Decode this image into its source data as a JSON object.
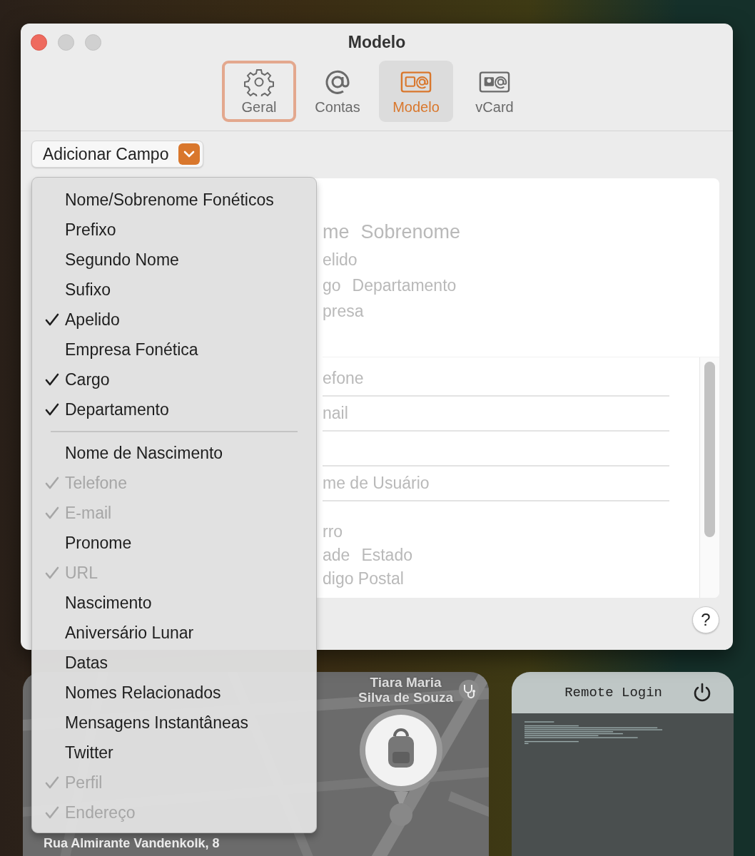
{
  "window": {
    "title": "Modelo"
  },
  "toolbar": [
    {
      "label": "Geral",
      "kind": "gear",
      "selected": false,
      "focused": true
    },
    {
      "label": "Contas",
      "kind": "at",
      "selected": false,
      "focused": false
    },
    {
      "label": "Modelo",
      "kind": "template",
      "selected": true,
      "focused": false
    },
    {
      "label": "vCard",
      "kind": "vcard",
      "selected": false,
      "focused": false
    }
  ],
  "add_field_button": {
    "label": "Adicionar Campo"
  },
  "template_preview": [
    {
      "kind": "name",
      "texts": [
        "me",
        "Sobrenome"
      ]
    },
    {
      "kind": "line",
      "texts": [
        "elido"
      ]
    },
    {
      "kind": "line",
      "texts": [
        "go",
        "Departamento"
      ]
    },
    {
      "kind": "line",
      "texts": [
        "presa"
      ]
    },
    {
      "kind": "field",
      "texts": [
        "efone"
      ]
    },
    {
      "kind": "field",
      "texts": [
        "nail"
      ]
    },
    {
      "kind": "field"
    },
    {
      "kind": "field",
      "texts": [
        "me de Usuário"
      ]
    },
    {
      "kind": "address",
      "texts": [
        "rro"
      ]
    },
    {
      "kind": "address",
      "texts": [
        "ade",
        "Estado"
      ]
    },
    {
      "kind": "address",
      "texts": [
        "digo Postal"
      ]
    }
  ],
  "help_button": {
    "label": "?"
  },
  "menu": {
    "groups": [
      [
        {
          "label": "Nome/Sobrenome Fonéticos",
          "checked": false,
          "disabled": false
        },
        {
          "label": "Prefixo",
          "checked": false,
          "disabled": false
        },
        {
          "label": "Segundo Nome",
          "checked": false,
          "disabled": false
        },
        {
          "label": "Sufixo",
          "checked": false,
          "disabled": false
        },
        {
          "label": "Apelido",
          "checked": true,
          "disabled": false
        },
        {
          "label": "Empresa Fonética",
          "checked": false,
          "disabled": false
        },
        {
          "label": "Cargo",
          "checked": true,
          "disabled": false
        },
        {
          "label": "Departamento",
          "checked": true,
          "disabled": false
        }
      ],
      [
        {
          "label": "Nome de Nascimento",
          "checked": false,
          "disabled": false
        },
        {
          "label": "Telefone",
          "checked": true,
          "disabled": true
        },
        {
          "label": "E-mail",
          "checked": true,
          "disabled": true
        },
        {
          "label": "Pronome",
          "checked": false,
          "disabled": false
        },
        {
          "label": "URL",
          "checked": true,
          "disabled": true
        },
        {
          "label": "Nascimento",
          "checked": false,
          "disabled": false
        },
        {
          "label": "Aniversário Lunar",
          "checked": false,
          "disabled": false
        },
        {
          "label": "Datas",
          "checked": false,
          "disabled": false
        },
        {
          "label": "Nomes Relacionados",
          "checked": false,
          "disabled": false
        },
        {
          "label": "Mensagens Instantâneas",
          "checked": false,
          "disabled": false
        },
        {
          "label": "Twitter",
          "checked": false,
          "disabled": false
        },
        {
          "label": "Perfil",
          "checked": true,
          "disabled": true
        },
        {
          "label": "Endereço",
          "checked": true,
          "disabled": true
        }
      ]
    ]
  },
  "map_widget": {
    "title_lines": [
      "Tiara Maria",
      "Silva de Souza"
    ],
    "address": "Rua Almirante Vandenkolk, 8"
  },
  "remote_login_widget": {
    "title": "Remote Login"
  }
}
